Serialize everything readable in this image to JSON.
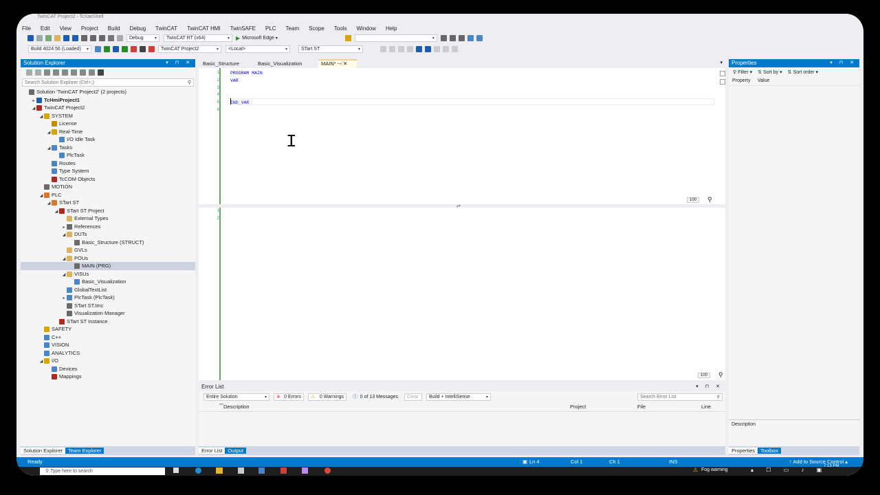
{
  "window": {
    "title": "TwinCAT Project2 - TcXaeShell"
  },
  "menu": [
    "File",
    "Edit",
    "View",
    "Project",
    "Build",
    "Debug",
    "TwinCAT",
    "TwinCAT HMI",
    "TwinSAFE",
    "PLC",
    "Team",
    "Scope",
    "Tools",
    "Window",
    "Help"
  ],
  "toolbar": {
    "config": "Debug",
    "platform": "TwinCAT RT (x64)",
    "run_target": "Microsoft Edge",
    "build": "Build 4024.56 (Loaded)",
    "project": "TwinCAT Project2",
    "target": "<Local>",
    "plc": "STart ST"
  },
  "solution_explorer": {
    "title": "Solution Explorer",
    "search_placeholder": "Search Solution Explorer (Ctrl+;)",
    "tree": [
      {
        "label": "Solution 'TwinCAT Project2' (2 projects)",
        "indent": 0,
        "exp": "",
        "icon": "#6a6a6a"
      },
      {
        "label": "TcHmiProject1",
        "indent": 1,
        "exp": "▸",
        "icon": "#1e5cb3",
        "bold": true
      },
      {
        "label": "TwinCAT Project2",
        "indent": 1,
        "exp": "◢",
        "icon": "#b3261e"
      },
      {
        "label": "SYSTEM",
        "indent": 2,
        "exp": "◢",
        "icon": "#d9a300"
      },
      {
        "label": "License",
        "indent": 3,
        "exp": "",
        "icon": "#c98b00"
      },
      {
        "label": "Real-Time",
        "indent": 3,
        "exp": "◢",
        "icon": "#d9a300"
      },
      {
        "label": "I/O Idle Task",
        "indent": 4,
        "exp": "",
        "icon": "#4a86c5"
      },
      {
        "label": "Tasks",
        "indent": 3,
        "exp": "◢",
        "icon": "#4a86c5"
      },
      {
        "label": "PlcTask",
        "indent": 4,
        "exp": "",
        "icon": "#4a86c5"
      },
      {
        "label": "Routes",
        "indent": 3,
        "exp": "",
        "icon": "#4a86c5"
      },
      {
        "label": "Type System",
        "indent": 3,
        "exp": "",
        "icon": "#4a86c5"
      },
      {
        "label": "TcCOM Objects",
        "indent": 3,
        "exp": "",
        "icon": "#b3261e"
      },
      {
        "label": "MOTION",
        "indent": 2,
        "exp": "",
        "icon": "#6a6a6a"
      },
      {
        "label": "PLC",
        "indent": 2,
        "exp": "◢",
        "icon": "#d9762b"
      },
      {
        "label": "STart ST",
        "indent": 3,
        "exp": "◢",
        "icon": "#d9762b"
      },
      {
        "label": "STart ST Project",
        "indent": 4,
        "exp": "◢",
        "icon": "#b3261e"
      },
      {
        "label": "External Types",
        "indent": 5,
        "exp": "",
        "icon": "#dcb35c"
      },
      {
        "label": "References",
        "indent": 5,
        "exp": "▸",
        "icon": "#6a6a6a"
      },
      {
        "label": "DUTs",
        "indent": 5,
        "exp": "◢",
        "icon": "#dcb35c"
      },
      {
        "label": "Basic_Structure (STRUCT)",
        "indent": 6,
        "exp": "",
        "icon": "#6a6a6a"
      },
      {
        "label": "GVLs",
        "indent": 5,
        "exp": "",
        "icon": "#dcb35c"
      },
      {
        "label": "POUs",
        "indent": 5,
        "exp": "◢",
        "icon": "#dcb35c"
      },
      {
        "label": "MAIN (PRG)",
        "indent": 6,
        "exp": "",
        "icon": "#6a6a6a",
        "selected": true
      },
      {
        "label": "VISUs",
        "indent": 5,
        "exp": "◢",
        "icon": "#dcb35c"
      },
      {
        "label": "Basic_Visualization",
        "indent": 6,
        "exp": "",
        "icon": "#4a86c5"
      },
      {
        "label": "GlobalTextList",
        "indent": 5,
        "exp": "",
        "icon": "#4a86c5"
      },
      {
        "label": "PlcTask (PlcTask)",
        "indent": 5,
        "exp": "▸",
        "icon": "#4a86c5"
      },
      {
        "label": "STart ST.tmc",
        "indent": 5,
        "exp": "",
        "icon": "#6a6a6a"
      },
      {
        "label": "Visualization Manager",
        "indent": 5,
        "exp": "",
        "icon": "#6a6a6a"
      },
      {
        "label": "STart ST Instance",
        "indent": 4,
        "exp": "",
        "icon": "#b3261e"
      },
      {
        "label": "SAFETY",
        "indent": 2,
        "exp": "",
        "icon": "#d9a300"
      },
      {
        "label": "C++",
        "indent": 2,
        "exp": "",
        "icon": "#4a86c5"
      },
      {
        "label": "VISION",
        "indent": 2,
        "exp": "",
        "icon": "#4a86c5"
      },
      {
        "label": "ANALYTICS",
        "indent": 2,
        "exp": "",
        "icon": "#4a86c5"
      },
      {
        "label": "I/O",
        "indent": 2,
        "exp": "◢",
        "icon": "#d9a300"
      },
      {
        "label": "Devices",
        "indent": 3,
        "exp": "",
        "icon": "#4a86c5"
      },
      {
        "label": "Mappings",
        "indent": 3,
        "exp": "",
        "icon": "#b3261e"
      }
    ],
    "bottom_tabs": [
      "Solution Explorer",
      "Team Explorer"
    ]
  },
  "editor": {
    "tabs": [
      {
        "label": "Basic_Structure",
        "active": false
      },
      {
        "label": "Basic_Visualization",
        "active": false
      },
      {
        "label": "MAIN*",
        "active": true
      }
    ],
    "decl_lines": [
      {
        "num": "1",
        "text": "PROGRAM MAIN"
      },
      {
        "num": "2",
        "text": "VAR"
      },
      {
        "num": "3",
        "text": ""
      },
      {
        "num": "4",
        "text": ""
      },
      {
        "num": "5",
        "text": "END_VAR"
      },
      {
        "num": "6",
        "text": ""
      }
    ],
    "impl_lines": [
      {
        "num": "1"
      },
      {
        "num": "2"
      }
    ],
    "zoom_top": "100",
    "zoom_bottom": "100"
  },
  "error_list": {
    "title": "Error List",
    "scope": "Entire Solution",
    "errors": "0 Errors",
    "warnings": "0 Warnings",
    "messages": "0 of 13 Messages",
    "clear": "Clear",
    "build": "Build + IntelliSense",
    "search_placeholder": "Search Error List",
    "columns": [
      "Description",
      "Project",
      "File",
      "Line"
    ],
    "bottom_tabs": [
      "Error List",
      "Output"
    ]
  },
  "properties": {
    "title": "Properties",
    "filter": "Filter",
    "sort_by": "Sort by",
    "sort_order": "Sort order",
    "col_property": "Property",
    "col_value": "Value",
    "description": "Description",
    "bottom_tabs": [
      "Properties",
      "Toolbox"
    ]
  },
  "status": {
    "ready": "Ready",
    "ln": "Ln 4",
    "col": "Col 1",
    "ch": "Ch 1",
    "ins": "INS",
    "source_control": "Add to Source Control"
  },
  "taskbar": {
    "search_placeholder": "Type here to search",
    "weather": "Fog warning",
    "time": "7:13 PM"
  }
}
